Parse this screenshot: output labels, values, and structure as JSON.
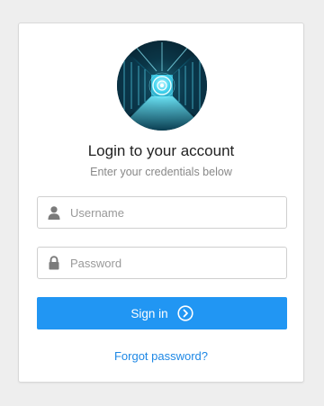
{
  "login": {
    "title": "Login to your account",
    "subtitle": "Enter your credentials below",
    "username": {
      "value": "",
      "placeholder": "Username",
      "icon": "user-icon"
    },
    "password": {
      "value": "",
      "placeholder": "Password",
      "icon": "lock-icon"
    },
    "signin_label": "Sign in",
    "signin_icon": "chevron-right-circle-icon",
    "forgot_label": "Forgot password?",
    "avatar_icon": "server-room-avatar"
  },
  "colors": {
    "primary": "#2196f3",
    "link": "#1e88e5",
    "background": "#eeeeee",
    "card": "#ffffff"
  }
}
